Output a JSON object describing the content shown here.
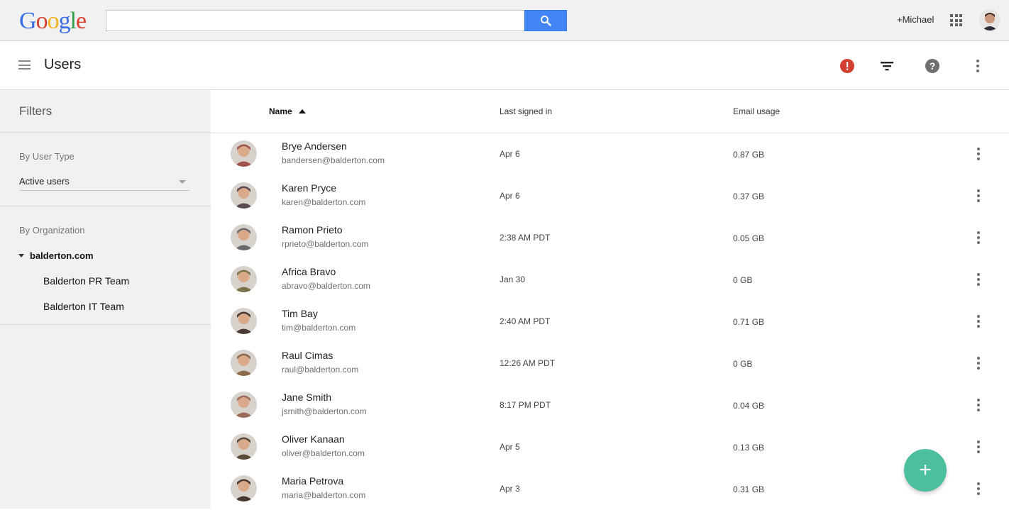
{
  "google_bar": {
    "logo_letters": [
      {
        "ch": "G",
        "color": "#3b6ee6"
      },
      {
        "ch": "o",
        "color": "#d9402f"
      },
      {
        "ch": "o",
        "color": "#f2b31d"
      },
      {
        "ch": "g",
        "color": "#3b6ee6"
      },
      {
        "ch": "l",
        "color": "#2e9c48"
      },
      {
        "ch": "e",
        "color": "#d9402f"
      }
    ],
    "search_value": "",
    "search_icon": "search-icon",
    "user_label": "+Michael",
    "apps_icon": "apps-grid-icon"
  },
  "header": {
    "menu_icon": "hamburger-menu-icon",
    "title": "Users",
    "icons": [
      "alert-icon",
      "filter-icon",
      "help-icon",
      "more-vert-icon"
    ],
    "alert_color": "#d23f31"
  },
  "sidebar": {
    "title": "Filters",
    "user_type_label": "By User Type",
    "user_type_value": "Active users",
    "org_label": "By Organization",
    "org_root": "balderton.com",
    "org_children": [
      "Balderton PR Team",
      "Balderton IT Team"
    ]
  },
  "table": {
    "columns": [
      "Name",
      "Last signed in",
      "Email usage"
    ],
    "rows": [
      {
        "name": "Brye Andersen",
        "email": "bandersen@balderton.com",
        "last": "Apr 6",
        "usage": "0.87 GB",
        "avatar_color": "#a0524a"
      },
      {
        "name": "Karen Pryce",
        "email": "karen@balderton.com",
        "last": "Apr 6",
        "usage": "0.37 GB",
        "avatar_color": "#5b4a52"
      },
      {
        "name": "Ramon Prieto",
        "email": "rprieto@balderton.com",
        "last": "2:38 AM PDT",
        "usage": "0.05 GB",
        "avatar_color": "#6a6a6a"
      },
      {
        "name": "Africa Bravo",
        "email": "abravo@balderton.com",
        "last": "Jan 30",
        "usage": "0 GB",
        "avatar_color": "#7a7148"
      },
      {
        "name": "Tim Bay",
        "email": "tim@balderton.com",
        "last": "2:40 AM PDT",
        "usage": "0.71 GB",
        "avatar_color": "#4a3a32"
      },
      {
        "name": "Raul Cimas",
        "email": "raul@balderton.com",
        "last": "12:26 AM PDT",
        "usage": "0 GB",
        "avatar_color": "#8a6a4a"
      },
      {
        "name": "Jane Smith",
        "email": "jsmith@balderton.com",
        "last": "8:17 PM PDT",
        "usage": "0.04 GB",
        "avatar_color": "#9a6a5a"
      },
      {
        "name": "Oliver Kanaan",
        "email": "oliver@balderton.com",
        "last": "Apr 5",
        "usage": "0.13 GB",
        "avatar_color": "#5a4a3a"
      },
      {
        "name": "Maria Petrova",
        "email": "maria@balderton.com",
        "last": "Apr 3",
        "usage": "0.31 GB",
        "avatar_color": "#4a3630"
      }
    ]
  },
  "fab": {
    "icon": "plus-icon",
    "label": "+",
    "color": "#4dbf9f"
  }
}
